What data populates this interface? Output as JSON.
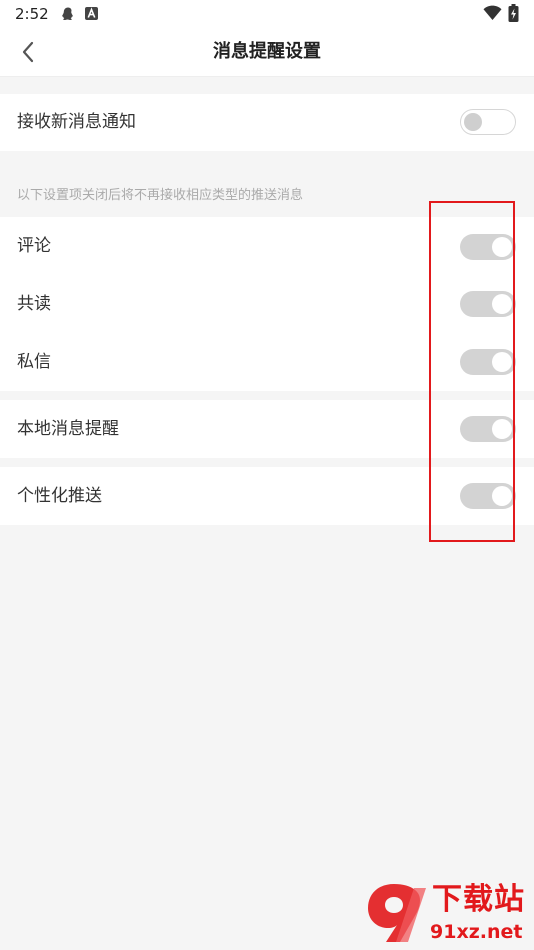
{
  "status_bar": {
    "time": "2:52",
    "icons_left": [
      "qq-icon",
      "a-badge-icon"
    ],
    "icons_right": [
      "wifi-icon",
      "battery-charging-icon"
    ]
  },
  "nav": {
    "title": "消息提醒设置",
    "back_icon": "chevron-left-icon"
  },
  "master": {
    "label": "接收新消息通知",
    "enabled": false
  },
  "section_hint": "以下设置项关闭后将不再接收相应类型的推送消息",
  "items": [
    {
      "label": "评论",
      "enabled": true,
      "disabled": true
    },
    {
      "label": "共读",
      "enabled": true,
      "disabled": true
    },
    {
      "label": "私信",
      "enabled": true,
      "disabled": true
    }
  ],
  "local_reminder": {
    "label": "本地消息提醒",
    "enabled": true,
    "disabled": true
  },
  "personalized_push": {
    "label": "个性化推送",
    "enabled": true,
    "disabled": true
  },
  "watermark": {
    "title": "下载站",
    "url": "91xz.net"
  },
  "colors": {
    "accent_red": "#e2191c",
    "background": "#f5f5f5",
    "toggle_disabled": "#d3d3d3"
  }
}
